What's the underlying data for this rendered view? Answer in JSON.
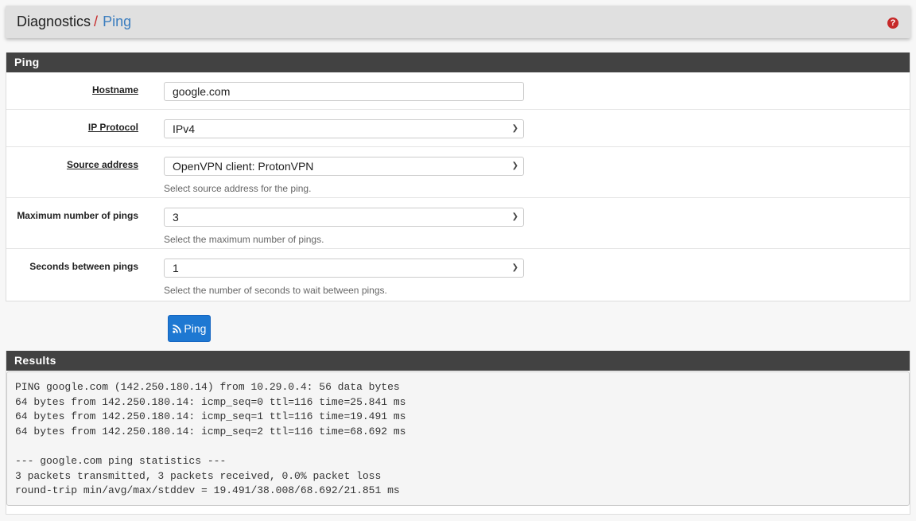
{
  "breadcrumb": {
    "parent": "Diagnostics",
    "separator": "/",
    "current": "Ping"
  },
  "help_icon": "question-circle-icon",
  "ping_panel": {
    "title": "Ping",
    "fields": [
      {
        "label": "Hostname",
        "value": "google.com",
        "type": "text"
      },
      {
        "label": "IP Protocol",
        "value": "IPv4",
        "type": "select"
      },
      {
        "label": "Source address",
        "value": "OpenVPN client: ProtonVPN",
        "type": "select",
        "hint": "Select source address for the ping."
      },
      {
        "label": "Maximum number of pings",
        "value": "3",
        "type": "select",
        "hint": "Select the maximum number of pings."
      },
      {
        "label": "Seconds between pings",
        "value": "1",
        "type": "select",
        "hint": "Select the number of seconds to wait between pings."
      }
    ]
  },
  "ping_button": {
    "label": "Ping",
    "icon": "rss-icon",
    "color": "#1e78d2"
  },
  "results": {
    "title": "Results",
    "output": "PING google.com (142.250.180.14) from 10.29.0.4: 56 data bytes\n64 bytes from 142.250.180.14: icmp_seq=0 ttl=116 time=25.841 ms\n64 bytes from 142.250.180.14: icmp_seq=1 ttl=116 time=19.491 ms\n64 bytes from 142.250.180.14: icmp_seq=2 ttl=116 time=68.692 ms\n\n--- google.com ping statistics ---\n3 packets transmitted, 3 packets received, 0.0% packet loss\nround-trip min/avg/max/stddev = 19.491/38.008/68.692/21.851 ms"
  }
}
